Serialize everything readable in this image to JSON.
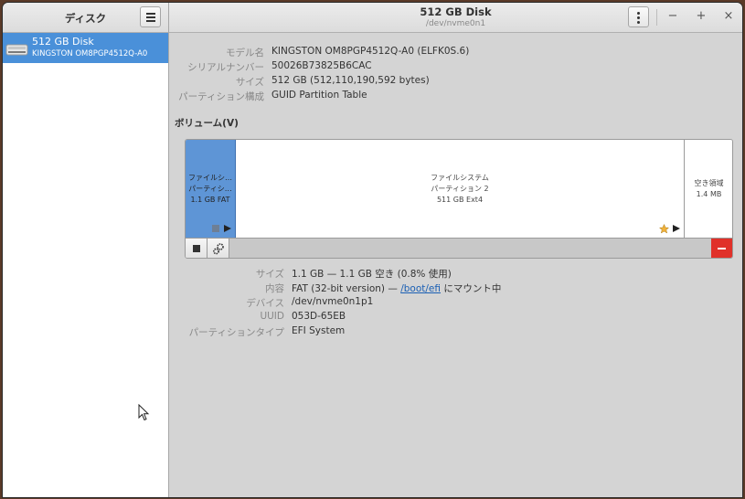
{
  "sidebar": {
    "title": "ディスク",
    "disks": [
      {
        "name": "512 GB Disk",
        "model": "KINGSTON OM8PGP4512Q-A0",
        "selected": true
      }
    ]
  },
  "header": {
    "title": "512 GB Disk",
    "subtitle": "/dev/nvme0n1",
    "minimize": "−",
    "maximize": "+",
    "close": "×"
  },
  "drive_info": {
    "model_label": "モデル名",
    "model": "KINGSTON OM8PGP4512Q-A0 (ELFK0S.6)",
    "serial_label": "シリアルナンバー",
    "serial": "50026B73825B6CAC",
    "size_label": "サイズ",
    "size": "512 GB (512,110,190,592 bytes)",
    "partitioning_label": "パーティション構成",
    "partitioning": "GUID Partition Table"
  },
  "volumes": {
    "heading": "ボリューム(V)",
    "segments": [
      {
        "line1": "ファイルシ…",
        "line2": "パーティシ…",
        "line3": "1.1 GB FAT",
        "selected": true
      },
      {
        "line1": "ファイルシステム",
        "line2": "パーティション 2",
        "line3": "511 GB Ext4",
        "selected": false
      },
      {
        "line1": "空き領域",
        "line2": "1.4 MB",
        "selected": false
      }
    ],
    "accent_color": "#5e95d6",
    "delete_color": "#e0312a"
  },
  "partition_info": {
    "size_label": "サイズ",
    "size": "1.1 GB — 1.1 GB 空き (0.8% 使用)",
    "contents_label": "内容",
    "contents_prefix": "FAT (32-bit version) — ",
    "mount_link": "/boot/efi",
    "contents_suffix": " にマウント中",
    "device_label": "デバイス",
    "device": "/dev/nvme0n1p1",
    "uuid_label": "UUID",
    "uuid": "053D-65EB",
    "type_label": "パーティションタイプ",
    "type": "EFI System"
  },
  "icons": [
    "hamburger-menu-icon",
    "drive-harddisk-icon",
    "kebab-menu-icon",
    "stop-icon",
    "gears-icon",
    "minus-icon",
    "play-icon",
    "star-icon",
    "mouse-pointer-icon"
  ]
}
